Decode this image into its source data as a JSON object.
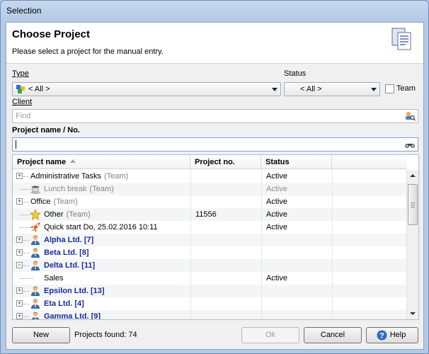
{
  "window": {
    "title": "Selection"
  },
  "header": {
    "title": "Choose Project",
    "subtitle": "Please select a project for the manual entry."
  },
  "filters": {
    "type_label": "Type",
    "type_value": "< All >",
    "status_label": "Status",
    "status_value": "< All >",
    "team_label": "Team",
    "team_checked": false,
    "client_label": "Client",
    "client_placeholder": "Find",
    "project_label": "Project name / No.",
    "project_value": ""
  },
  "grid": {
    "columns": [
      "Project name",
      "Project no.",
      "Status"
    ],
    "rows": [
      {
        "name": "Administrative Tasks",
        "team": "(Team)",
        "no": "",
        "status": "Active",
        "style": "normal",
        "toggle": "+",
        "icon": "none-icon",
        "indent": 0
      },
      {
        "name": "Lunch break",
        "team": "(Team)",
        "no": "",
        "status": "Active",
        "style": "grey",
        "toggle": "",
        "icon": "coffee-cup-icon",
        "indent": 1
      },
      {
        "name": "Office",
        "team": "(Team)",
        "no": "",
        "status": "Active",
        "style": "normal",
        "toggle": "+",
        "icon": "none-icon",
        "indent": 0
      },
      {
        "name": "Other",
        "team": "(Team)",
        "no": "11556",
        "status": "Active",
        "style": "normal",
        "toggle": "",
        "icon": "star-icon",
        "indent": 1
      },
      {
        "name": "Quick start Do, 25.02.2016 10:11",
        "team": "",
        "no": "",
        "status": "Active",
        "style": "normal",
        "toggle": "",
        "icon": "rocket-icon",
        "indent": 1
      },
      {
        "name": "Alpha Ltd. [7]",
        "team": "",
        "no": "",
        "status": "",
        "style": "blue",
        "toggle": "+",
        "icon": "person-icon",
        "indent": 0
      },
      {
        "name": "Beta Ltd. [8]",
        "team": "",
        "no": "",
        "status": "",
        "style": "blue",
        "toggle": "+",
        "icon": "person-icon",
        "indent": 0
      },
      {
        "name": "Delta Ltd. [11]",
        "team": "",
        "no": "",
        "status": "",
        "style": "blue",
        "toggle": "−",
        "icon": "person-icon",
        "indent": 0
      },
      {
        "name": "Sales",
        "team": "",
        "no": "",
        "status": "Active",
        "style": "normal",
        "toggle": "",
        "icon": "none-icon",
        "indent": 1
      },
      {
        "name": "Epsilon Ltd. [13]",
        "team": "",
        "no": "",
        "status": "",
        "style": "blue",
        "toggle": "+",
        "icon": "person-icon",
        "indent": 0
      },
      {
        "name": "Eta Ltd. [4]",
        "team": "",
        "no": "",
        "status": "",
        "style": "blue",
        "toggle": "+",
        "icon": "person-icon",
        "indent": 0
      },
      {
        "name": "Gamma Ltd. [9]",
        "team": "",
        "no": "",
        "status": "",
        "style": "blue",
        "toggle": "+",
        "icon": "person-icon",
        "indent": 0
      }
    ]
  },
  "footer": {
    "new_label": "New",
    "found_text": "Projects found: 74",
    "ok_label": "Ok",
    "cancel_label": "Cancel",
    "help_label": "Help"
  },
  "colors": {
    "accent": "#1a2a9a",
    "window_frame": "#b4c9e4"
  }
}
